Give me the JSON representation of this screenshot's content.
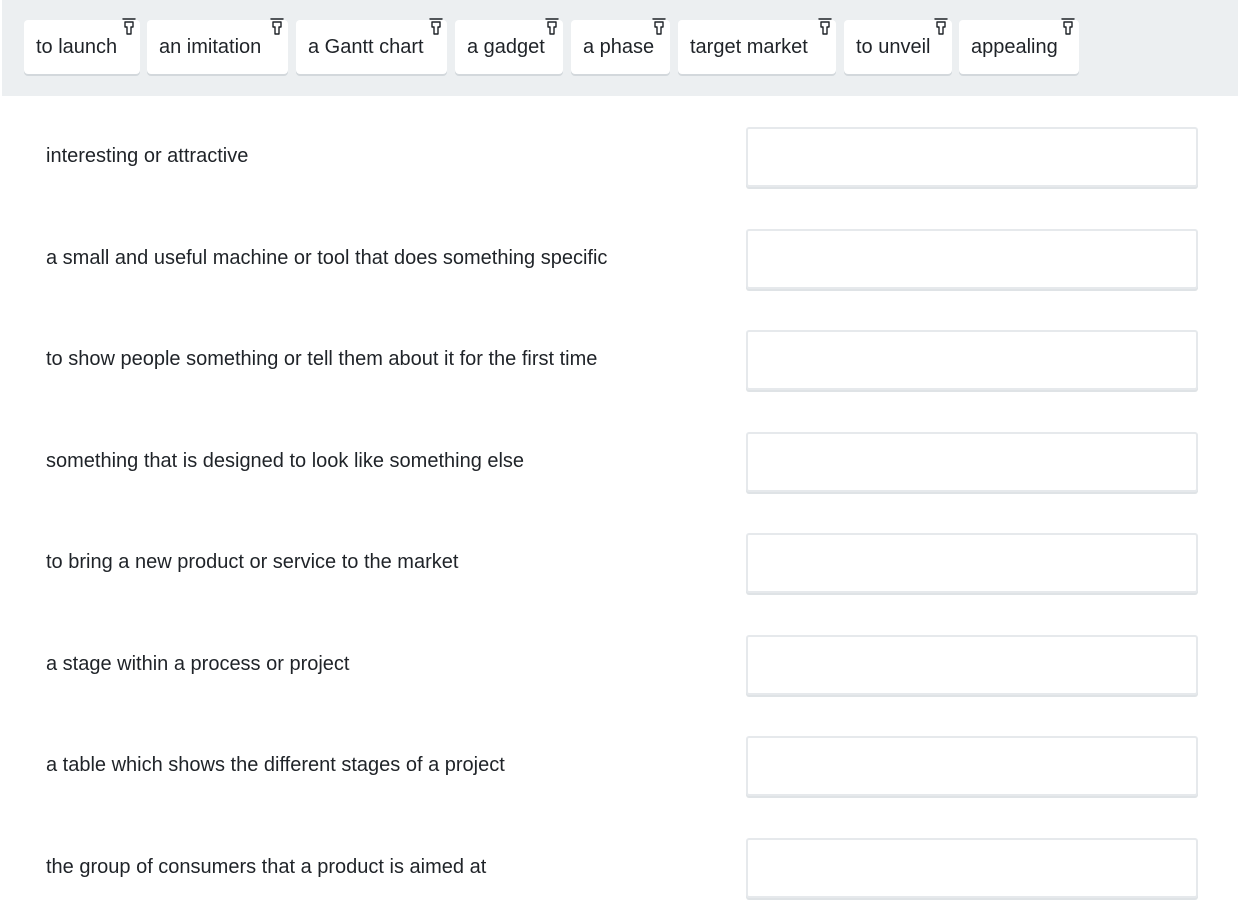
{
  "word_bank": {
    "chips": [
      {
        "label": "to launch"
      },
      {
        "label": "an imitation"
      },
      {
        "label": "a Gantt chart"
      },
      {
        "label": "a gadget"
      },
      {
        "label": "a phase"
      },
      {
        "label": "target market"
      },
      {
        "label": "to unveil"
      },
      {
        "label": "appealing"
      }
    ],
    "chip_icon": "drag-pointer-icon"
  },
  "rows": [
    {
      "definition": "interesting or attractive",
      "answer": ""
    },
    {
      "definition": "a small and useful machine or tool that does something specific",
      "answer": ""
    },
    {
      "definition": "to show people something or tell them about it for the first time",
      "answer": ""
    },
    {
      "definition": "something that is designed to look like something else",
      "answer": ""
    },
    {
      "definition": "to bring a new product or service to the market",
      "answer": ""
    },
    {
      "definition": "a stage within a process or project",
      "answer": ""
    },
    {
      "definition": "a table which shows the different stages of a project",
      "answer": ""
    },
    {
      "definition": "the group of consumers that a product is aimed at",
      "answer": ""
    }
  ]
}
